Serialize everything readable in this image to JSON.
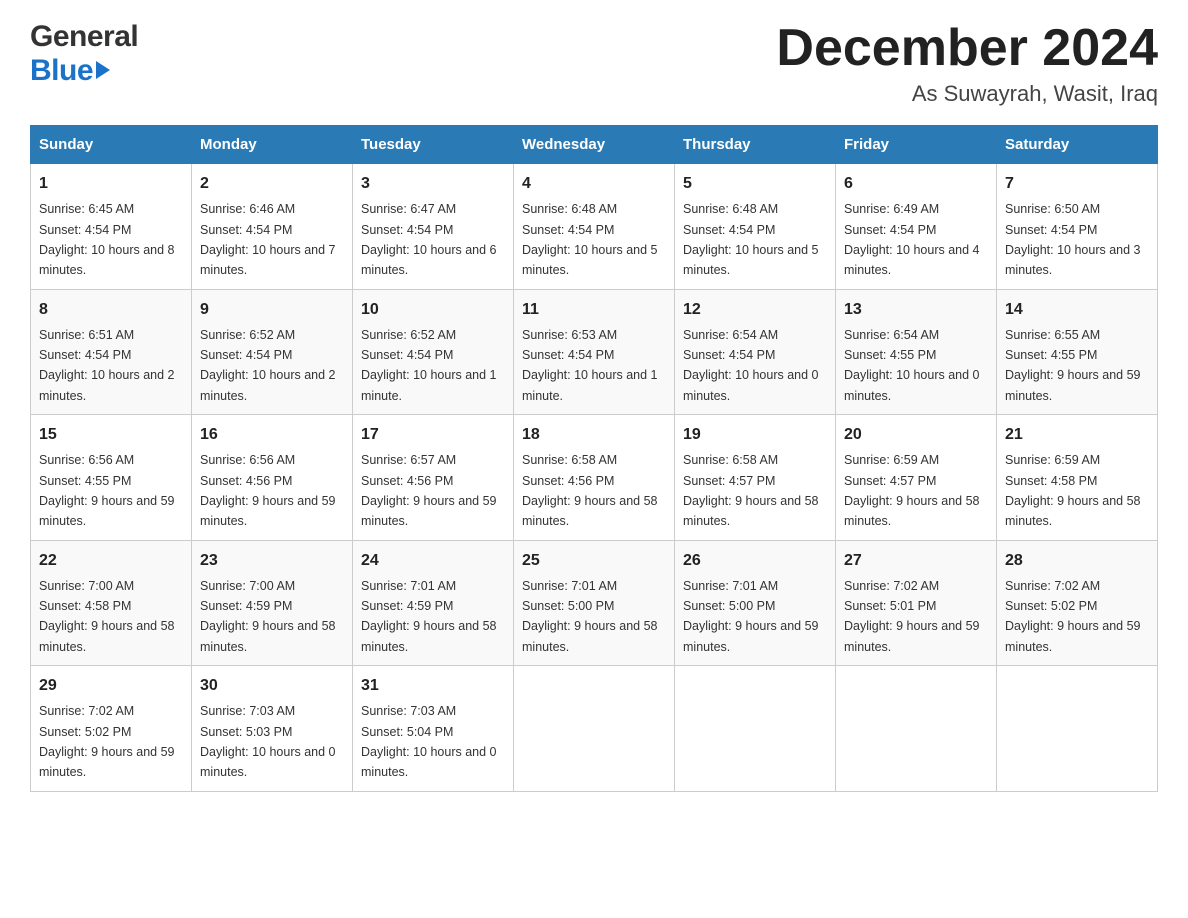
{
  "header": {
    "month_year": "December 2024",
    "location": "As Suwayrah, Wasit, Iraq",
    "logo_top": "General",
    "logo_bottom": "Blue"
  },
  "columns": [
    "Sunday",
    "Monday",
    "Tuesday",
    "Wednesday",
    "Thursday",
    "Friday",
    "Saturday"
  ],
  "weeks": [
    [
      {
        "day": "1",
        "sunrise": "6:45 AM",
        "sunset": "4:54 PM",
        "daylight": "10 hours and 8 minutes."
      },
      {
        "day": "2",
        "sunrise": "6:46 AM",
        "sunset": "4:54 PM",
        "daylight": "10 hours and 7 minutes."
      },
      {
        "day": "3",
        "sunrise": "6:47 AM",
        "sunset": "4:54 PM",
        "daylight": "10 hours and 6 minutes."
      },
      {
        "day": "4",
        "sunrise": "6:48 AM",
        "sunset": "4:54 PM",
        "daylight": "10 hours and 5 minutes."
      },
      {
        "day": "5",
        "sunrise": "6:48 AM",
        "sunset": "4:54 PM",
        "daylight": "10 hours and 5 minutes."
      },
      {
        "day": "6",
        "sunrise": "6:49 AM",
        "sunset": "4:54 PM",
        "daylight": "10 hours and 4 minutes."
      },
      {
        "day": "7",
        "sunrise": "6:50 AM",
        "sunset": "4:54 PM",
        "daylight": "10 hours and 3 minutes."
      }
    ],
    [
      {
        "day": "8",
        "sunrise": "6:51 AM",
        "sunset": "4:54 PM",
        "daylight": "10 hours and 2 minutes."
      },
      {
        "day": "9",
        "sunrise": "6:52 AM",
        "sunset": "4:54 PM",
        "daylight": "10 hours and 2 minutes."
      },
      {
        "day": "10",
        "sunrise": "6:52 AM",
        "sunset": "4:54 PM",
        "daylight": "10 hours and 1 minute."
      },
      {
        "day": "11",
        "sunrise": "6:53 AM",
        "sunset": "4:54 PM",
        "daylight": "10 hours and 1 minute."
      },
      {
        "day": "12",
        "sunrise": "6:54 AM",
        "sunset": "4:54 PM",
        "daylight": "10 hours and 0 minutes."
      },
      {
        "day": "13",
        "sunrise": "6:54 AM",
        "sunset": "4:55 PM",
        "daylight": "10 hours and 0 minutes."
      },
      {
        "day": "14",
        "sunrise": "6:55 AM",
        "sunset": "4:55 PM",
        "daylight": "9 hours and 59 minutes."
      }
    ],
    [
      {
        "day": "15",
        "sunrise": "6:56 AM",
        "sunset": "4:55 PM",
        "daylight": "9 hours and 59 minutes."
      },
      {
        "day": "16",
        "sunrise": "6:56 AM",
        "sunset": "4:56 PM",
        "daylight": "9 hours and 59 minutes."
      },
      {
        "day": "17",
        "sunrise": "6:57 AM",
        "sunset": "4:56 PM",
        "daylight": "9 hours and 59 minutes."
      },
      {
        "day": "18",
        "sunrise": "6:58 AM",
        "sunset": "4:56 PM",
        "daylight": "9 hours and 58 minutes."
      },
      {
        "day": "19",
        "sunrise": "6:58 AM",
        "sunset": "4:57 PM",
        "daylight": "9 hours and 58 minutes."
      },
      {
        "day": "20",
        "sunrise": "6:59 AM",
        "sunset": "4:57 PM",
        "daylight": "9 hours and 58 minutes."
      },
      {
        "day": "21",
        "sunrise": "6:59 AM",
        "sunset": "4:58 PM",
        "daylight": "9 hours and 58 minutes."
      }
    ],
    [
      {
        "day": "22",
        "sunrise": "7:00 AM",
        "sunset": "4:58 PM",
        "daylight": "9 hours and 58 minutes."
      },
      {
        "day": "23",
        "sunrise": "7:00 AM",
        "sunset": "4:59 PM",
        "daylight": "9 hours and 58 minutes."
      },
      {
        "day": "24",
        "sunrise": "7:01 AM",
        "sunset": "4:59 PM",
        "daylight": "9 hours and 58 minutes."
      },
      {
        "day": "25",
        "sunrise": "7:01 AM",
        "sunset": "5:00 PM",
        "daylight": "9 hours and 58 minutes."
      },
      {
        "day": "26",
        "sunrise": "7:01 AM",
        "sunset": "5:00 PM",
        "daylight": "9 hours and 59 minutes."
      },
      {
        "day": "27",
        "sunrise": "7:02 AM",
        "sunset": "5:01 PM",
        "daylight": "9 hours and 59 minutes."
      },
      {
        "day": "28",
        "sunrise": "7:02 AM",
        "sunset": "5:02 PM",
        "daylight": "9 hours and 59 minutes."
      }
    ],
    [
      {
        "day": "29",
        "sunrise": "7:02 AM",
        "sunset": "5:02 PM",
        "daylight": "9 hours and 59 minutes."
      },
      {
        "day": "30",
        "sunrise": "7:03 AM",
        "sunset": "5:03 PM",
        "daylight": "10 hours and 0 minutes."
      },
      {
        "day": "31",
        "sunrise": "7:03 AM",
        "sunset": "5:04 PM",
        "daylight": "10 hours and 0 minutes."
      },
      null,
      null,
      null,
      null
    ]
  ],
  "labels": {
    "sunrise": "Sunrise:",
    "sunset": "Sunset:",
    "daylight": "Daylight:"
  }
}
